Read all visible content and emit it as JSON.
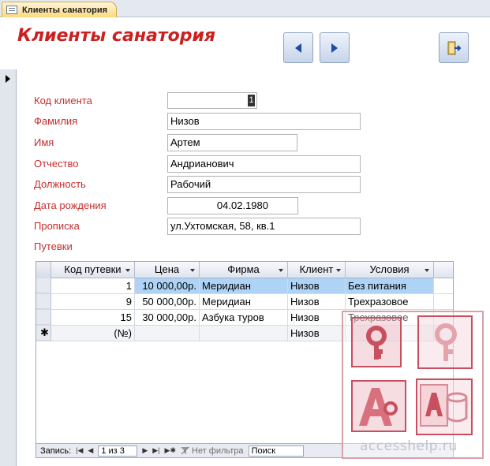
{
  "tab": {
    "title": "Клиенты санатория",
    "icon": "form-icon"
  },
  "header": {
    "title": "Клиенты санатория",
    "buttons": [
      {
        "name": "prev-record-button",
        "icon": "triangle-left-icon"
      },
      {
        "name": "next-record-button",
        "icon": "triangle-right-icon"
      },
      {
        "name": "close-form-button",
        "icon": "exit-door-icon"
      }
    ]
  },
  "fields": {
    "client_id": {
      "label": "Код клиента",
      "value": "1"
    },
    "surname": {
      "label": "Фамилия",
      "value": "Низов"
    },
    "name": {
      "label": "Имя",
      "value": "Артем"
    },
    "patronymic": {
      "label": "Отчество",
      "value": "Андрианович"
    },
    "position": {
      "label": "Должность",
      "value": "Рабочий"
    },
    "birth_date": {
      "label": "Дата рождения",
      "value": "04.02.1980"
    },
    "registration": {
      "label": "Прописка",
      "value": "ул.Ухтомская, 58, кв.1"
    },
    "trips": {
      "label": "Путевки"
    }
  },
  "subform": {
    "columns": [
      "Код путевки",
      "Цена",
      "Фирма",
      "Клиент",
      "Условия"
    ],
    "rows": [
      {
        "id": "1",
        "price": "10 000,00р.",
        "firm": "Меридиан",
        "client": "Низов",
        "conditions": "Без питания"
      },
      {
        "id": "9",
        "price": "50 000,00р.",
        "firm": "Меридиан",
        "client": "Низов",
        "conditions": "Трехразовое"
      },
      {
        "id": "15",
        "price": "30 000,00р.",
        "firm": "Азбука туров",
        "client": "Низов",
        "conditions": "Трехразовое"
      }
    ],
    "new_row": {
      "marker": "✱",
      "id": "(№)",
      "client": "Низов"
    },
    "navigation": {
      "record_label": "Запись:",
      "position": "1 из 3",
      "filter_label": "Нет фильтра",
      "search_placeholder": "Поиск"
    }
  },
  "watermark": {
    "text": "accesshelp.ru"
  },
  "colors": {
    "label_red": "#c62d2d",
    "title_red": "#cc1f1f",
    "selection": "#aed3f5",
    "accent": "#1b4aa8"
  }
}
